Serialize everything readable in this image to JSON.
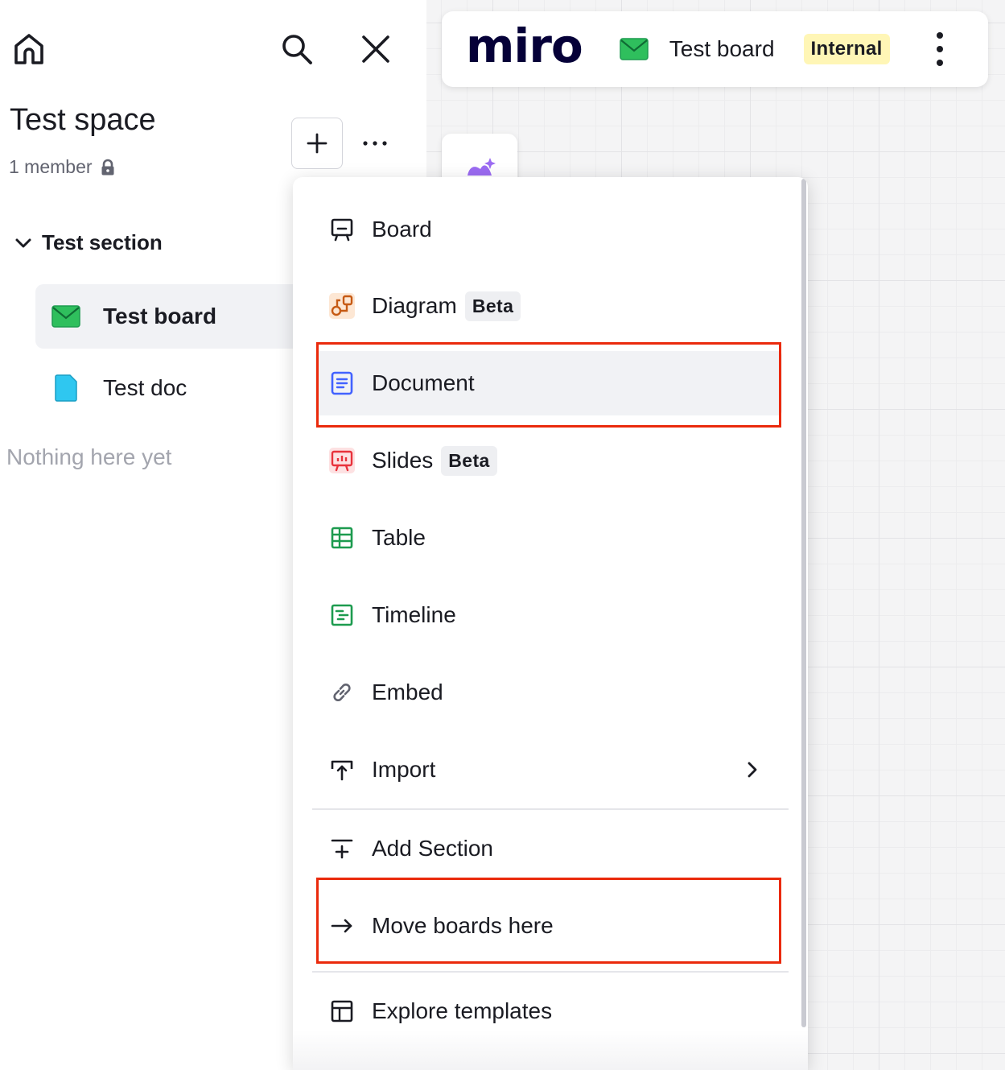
{
  "sidebar": {
    "space_title": "Test space",
    "member_count": "1 member",
    "section_label": "Test section",
    "items": [
      {
        "label": "Test board",
        "icon": "board-envelope-icon",
        "active": true
      },
      {
        "label": "Test doc",
        "icon": "doc-icon",
        "active": false
      }
    ],
    "empty_note": "Nothing here yet"
  },
  "board_bar": {
    "logo": "miro",
    "board_name": "Test board",
    "badge": "Internal"
  },
  "menu": {
    "items": [
      {
        "label": "Board",
        "icon": "board-icon"
      },
      {
        "label": "Diagram",
        "icon": "diagram-icon",
        "badge": "Beta"
      },
      {
        "label": "Document",
        "icon": "document-icon"
      },
      {
        "label": "Slides",
        "icon": "slides-icon",
        "badge": "Beta"
      },
      {
        "label": "Table",
        "icon": "table-icon"
      },
      {
        "label": "Timeline",
        "icon": "timeline-icon"
      },
      {
        "label": "Embed",
        "icon": "link-icon"
      },
      {
        "label": "Import",
        "icon": "import-icon"
      },
      {
        "label": "Add Section",
        "icon": "add-section-icon"
      },
      {
        "label": "Move boards here",
        "icon": "arrow-right-icon"
      },
      {
        "label": "Explore templates",
        "icon": "templates-icon"
      }
    ]
  },
  "colors": {
    "highlight": "#ea2a0c",
    "badge_internal_bg": "#fff6b6",
    "board_green": "#2fbf5d",
    "doc_blue": "#2fc7f0",
    "diagram_orange": "#e8732a",
    "slides_red": "#e8323c",
    "document_blue": "#4262ff",
    "table_green": "#1d9b4f"
  }
}
